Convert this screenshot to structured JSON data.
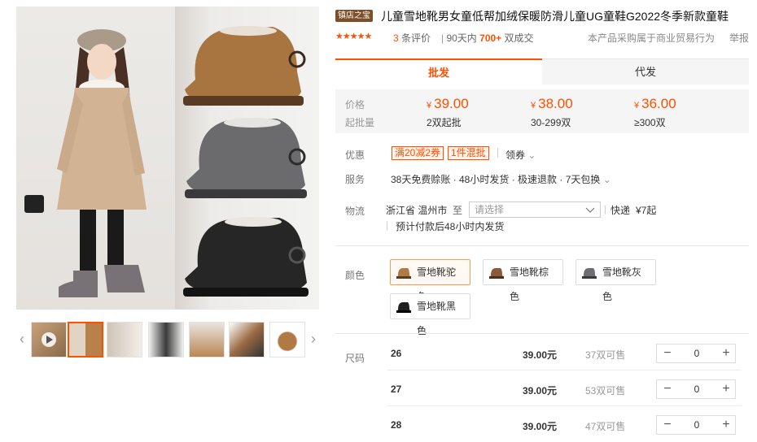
{
  "gallery": {
    "prev_arrow": "‹",
    "next_arrow": "›"
  },
  "product": {
    "store_tag": "镇店之宝",
    "title": "儿童雪地靴男女童低帮加绒保暖防滑儿童UG童鞋G2022冬季新款童鞋",
    "rating_stars": "★★★★★",
    "review_count": "3",
    "review_suffix": "条评价",
    "sales_prefix": "90天内",
    "sales_count": "700+",
    "sales_suffix": "双成交",
    "purpose_note": "本产品采购属于商业贸易行为",
    "report_label": "举报"
  },
  "tabs": {
    "wholesale": "批发",
    "dropship": "代发"
  },
  "pricing": {
    "price_label": "价格",
    "qty_label": "起批量",
    "currency": "¥",
    "tiers": [
      {
        "price": "39.00",
        "qty": "2双起批"
      },
      {
        "price": "38.00",
        "qty": "30-299双"
      },
      {
        "price": "36.00",
        "qty": "≥300双"
      }
    ]
  },
  "promo": {
    "label": "优惠",
    "coupons": [
      "满20减2券",
      "1件混批"
    ],
    "get_coupon": "领券",
    "chevron": "⌄"
  },
  "service": {
    "label": "服务",
    "text": "38天免费赊账 · 48小时发货 · 极速退款 · 7天包换",
    "chevron": "⌄"
  },
  "logistics": {
    "label": "物流",
    "origin": "浙江省 温州市",
    "to": "至",
    "placeholder": "请选择",
    "express": "快递",
    "fee": "¥7起",
    "note": "预计付款后48小时内发货"
  },
  "colors": {
    "label": "颜色",
    "options": [
      {
        "name": "雪地靴驼色",
        "swatch": "#b07a44"
      },
      {
        "name": "雪地靴棕色",
        "swatch": "#8a5a3a"
      },
      {
        "name": "雪地靴灰色",
        "swatch": "#6e6e72"
      },
      {
        "name": "雪地靴黑色",
        "swatch": "#1f1f1f"
      }
    ]
  },
  "sizes": {
    "label": "尺码",
    "rows": [
      {
        "size": "26",
        "price": "39.00元",
        "stock": "37双可售",
        "qty": "0"
      },
      {
        "size": "27",
        "price": "39.00元",
        "stock": "53双可售",
        "qty": "0"
      },
      {
        "size": "28",
        "price": "39.00元",
        "stock": "47双可售",
        "qty": "0"
      }
    ],
    "minus": "−",
    "plus": "+"
  }
}
